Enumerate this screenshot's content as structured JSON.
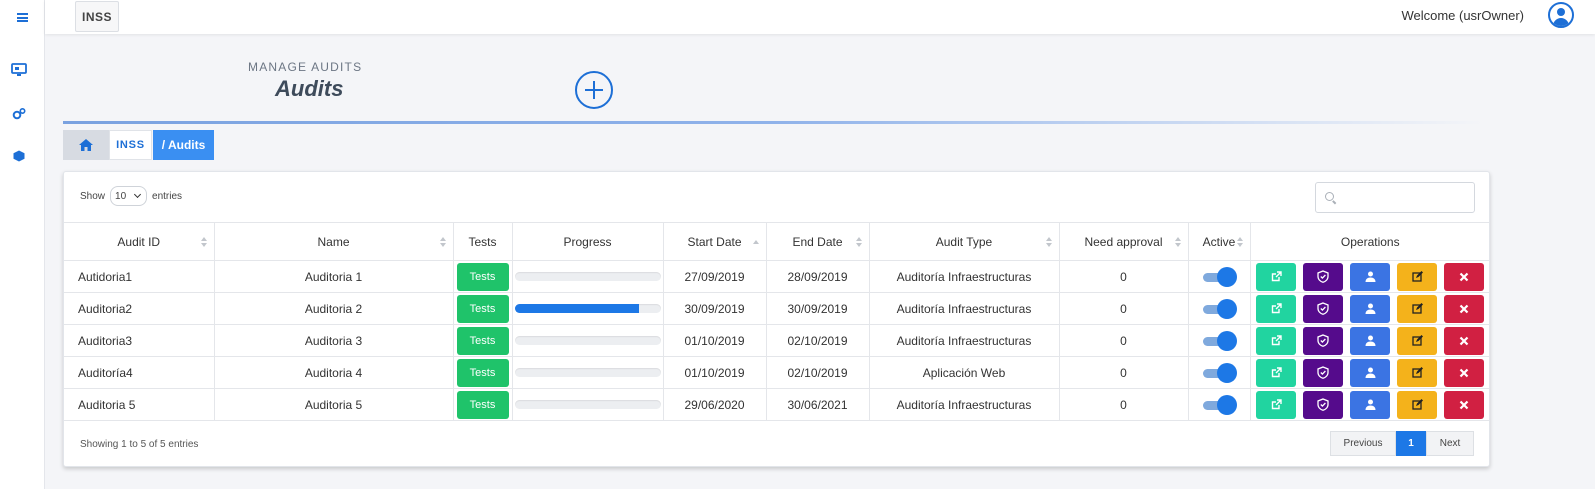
{
  "app": {
    "brand": "INSS",
    "welcome": "Welcome (usrOwner)"
  },
  "sidebar": {
    "icons": [
      "menu-icon",
      "monitor-icon",
      "gears-icon",
      "cube-icon"
    ]
  },
  "header": {
    "subtitle": "MANAGE AUDITS",
    "title": "Audits"
  },
  "breadcrumb": {
    "home_icon": "home-icon",
    "root": "INSS",
    "current": "/ Audits"
  },
  "table_controls": {
    "show_label": "Show",
    "page_size": "10",
    "entries_label": "entries",
    "search_placeholder": ""
  },
  "columns": [
    "Audit ID",
    "Name",
    "Tests",
    "Progress",
    "Start Date",
    "End Date",
    "Audit Type",
    "Need approval",
    "Active",
    "Operations"
  ],
  "rows": [
    {
      "id": "Autidoria1",
      "name": "Auditoria 1",
      "tests": "Tests",
      "progress": 0,
      "start": "27/09/2019",
      "end": "28/09/2019",
      "type": "Auditoría Infraestructuras",
      "approval": "0",
      "active": true
    },
    {
      "id": "Auditoria2",
      "name": "Auditoria 2",
      "tests": "Tests",
      "progress": 0.85,
      "start": "30/09/2019",
      "end": "30/09/2019",
      "type": "Auditoría Infraestructuras",
      "approval": "0",
      "active": true
    },
    {
      "id": "Auditoria3",
      "name": "Auditoria 3",
      "tests": "Tests",
      "progress": 0,
      "start": "01/10/2019",
      "end": "02/10/2019",
      "type": "Auditoría Infraestructuras",
      "approval": "0",
      "active": true
    },
    {
      "id": "Auditoría4",
      "name": "Auditoria 4",
      "tests": "Tests",
      "progress": 0,
      "start": "01/10/2019",
      "end": "02/10/2019",
      "type": "Aplicación Web",
      "approval": "0",
      "active": true
    },
    {
      "id": "Auditoria 5",
      "name": "Auditoria 5",
      "tests": "Tests",
      "progress": 0,
      "start": "29/06/2020",
      "end": "30/06/2021",
      "type": "Auditoría Infraestructuras",
      "approval": "0",
      "active": true
    }
  ],
  "operations": [
    "external-link-icon",
    "shield-check-icon",
    "user-icon",
    "edit-icon",
    "delete-icon"
  ],
  "footer": {
    "info": "Showing 1 to 5 of 5 entries",
    "prev": "Previous",
    "page": "1",
    "next": "Next"
  },
  "colors": {
    "accent": "#1d78e6",
    "tests": "#1fc36a",
    "op_link": "#21d4a0",
    "op_shield": "#550b8c",
    "op_user": "#3b74e3",
    "op_edit": "#f4b21b",
    "op_delete": "#d12042"
  }
}
